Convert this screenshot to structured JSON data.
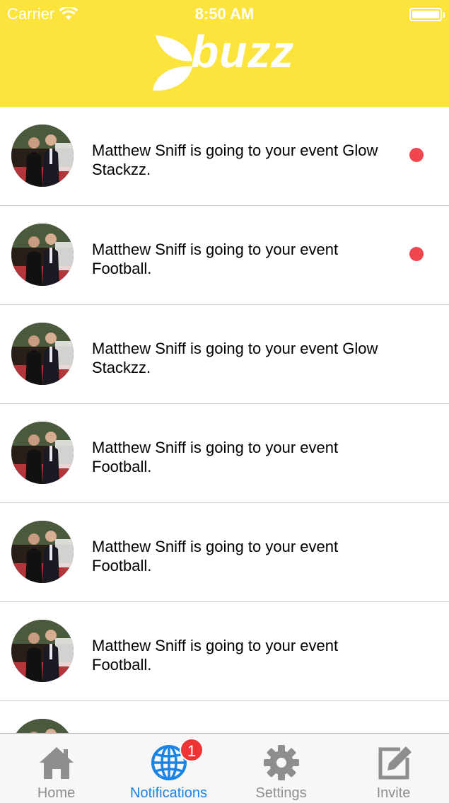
{
  "status_bar": {
    "carrier": "Carrier",
    "time": "8:50 AM",
    "wifi_icon": "wifi-icon",
    "battery_icon": "battery-icon"
  },
  "header": {
    "brand": "buzz",
    "background_color": "#fde43c"
  },
  "notifications": [
    {
      "text": "Matthew Sniff is going to your event Glow Stackzz.",
      "unread": true
    },
    {
      "text": "Matthew Sniff is going to your event Football.",
      "unread": true
    },
    {
      "text": "Matthew Sniff is going to your event Glow Stackzz.",
      "unread": false
    },
    {
      "text": "Matthew Sniff is going to your event Football.",
      "unread": false
    },
    {
      "text": "Matthew Sniff is going to your event Football.",
      "unread": false
    },
    {
      "text": "Matthew Sniff is going to your event Football.",
      "unread": false
    },
    {
      "text": "",
      "unread": false
    }
  ],
  "tabbar": {
    "tabs": [
      {
        "label": "Home",
        "icon": "home-icon"
      },
      {
        "label": "Notifications",
        "icon": "globe-icon",
        "badge": "1",
        "active": true
      },
      {
        "label": "Settings",
        "icon": "gear-icon"
      },
      {
        "label": "Invite",
        "icon": "edit-icon"
      }
    ]
  },
  "colors": {
    "accent": "#1a83e6",
    "unread_dot": "#f0464d",
    "badge": "#f03434"
  }
}
